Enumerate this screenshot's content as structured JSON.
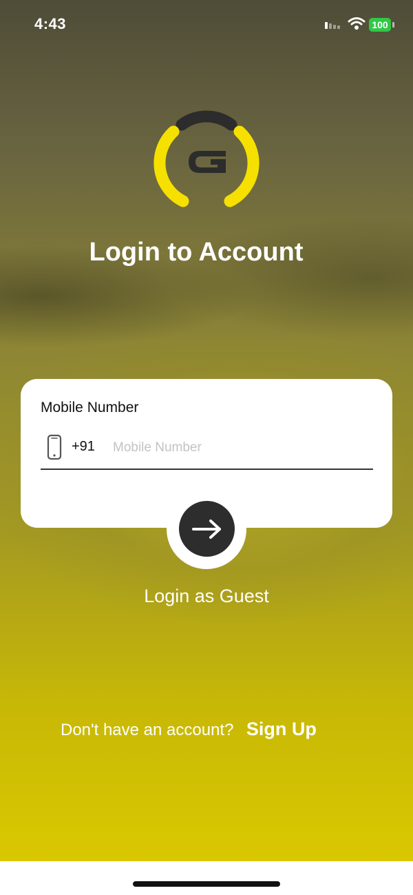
{
  "status_bar": {
    "time": "4:43",
    "battery": "100",
    "battery_color": "#30c846",
    "icons": [
      "signal-icon",
      "wifi-icon",
      "battery-icon"
    ]
  },
  "logo": {
    "letter": "G",
    "arc_color": "#f6e000",
    "top_color": "#2c2c2c"
  },
  "header": {
    "title": "Login to Account"
  },
  "form": {
    "label": "Mobile Number",
    "country_code": "+91",
    "mobile_value": "",
    "mobile_placeholder": "Mobile Number",
    "icon": "phone-icon"
  },
  "actions": {
    "submit_icon": "arrow-right-icon",
    "guest_label": "Login as Guest",
    "signup_question": "Don't have an account?",
    "signup_label": "Sign Up"
  },
  "theme": {
    "accent": "#d9c800",
    "button": "#2d2d2d"
  }
}
